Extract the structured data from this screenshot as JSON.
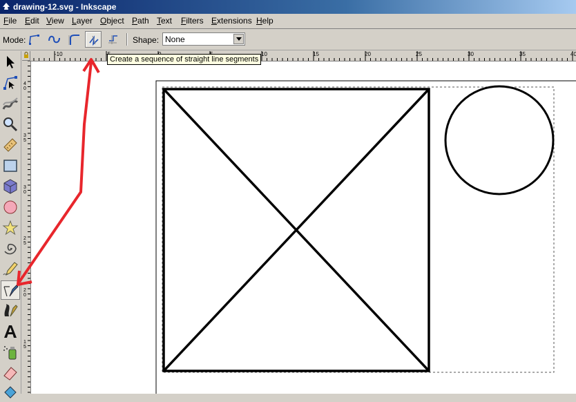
{
  "window": {
    "title": "drawing-12.svg - Inkscape"
  },
  "menu": [
    "File",
    "Edit",
    "View",
    "Layer",
    "Object",
    "Path",
    "Text",
    "Filters",
    "Extensions",
    "Help"
  ],
  "tool_controls": {
    "mode_label": "Mode:",
    "modes": [
      "regular-bezier-icon",
      "spiro-path-icon",
      "bspline-path-icon",
      "straight-line-segments-icon",
      "paraxial-line-segments-icon"
    ],
    "active_mode": "straight-line-segments-icon",
    "shape_label": "Shape:",
    "shape_value": "None"
  },
  "tooltip": "Create a sequence of straight line segments",
  "ruler": {
    "h_labels": [
      "-10",
      "-5",
      "0",
      "5",
      "10",
      "15",
      "20",
      "25",
      "30",
      "35",
      "40"
    ],
    "v_labels": [
      "4 0",
      "3 5",
      "3 0",
      "2 5",
      "2 0",
      "1 5"
    ]
  },
  "toolbox": [
    "selector-tool-icon",
    "node-tool-icon",
    "tweak-tool-icon",
    "zoom-tool-icon",
    "measure-tool-icon",
    "rect-tool-icon",
    "3dbox-tool-icon",
    "ellipse-tool-icon",
    "star-tool-icon",
    "spiral-tool-icon",
    "pencil-tool-icon",
    "pen-tool-icon",
    "calligraphy-tool-icon",
    "text-tool-icon",
    "spray-tool-icon",
    "eraser-tool-icon",
    "paint-bucket-tool-icon"
  ],
  "colors": {
    "annotation_arrow": "#e8262c",
    "title_bar": "#0a246a"
  }
}
